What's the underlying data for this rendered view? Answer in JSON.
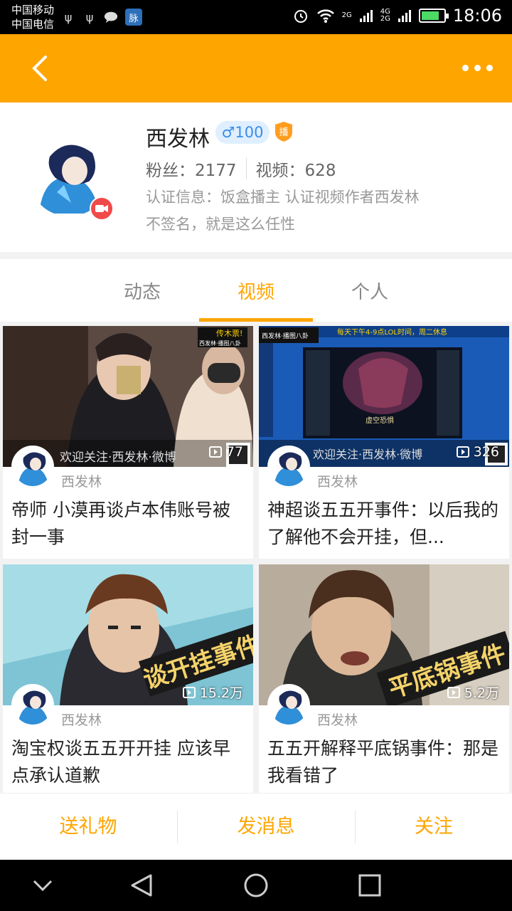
{
  "status": {
    "carrier1": "中国移动",
    "carrier2": "中国电信",
    "mai": "脉",
    "net_top": "4G",
    "net_bottom": "2G",
    "net2": "2G",
    "time": "18:06"
  },
  "profile": {
    "name": "西发林",
    "level": "♂100",
    "badge": "播",
    "fans": "粉丝：2177",
    "videos": "视频：628",
    "cert": "认证信息：饭盒播主 认证视频作者西发林",
    "sign": "不签名，就是这么任性"
  },
  "tabs": [
    "动态",
    "视频",
    "个人"
  ],
  "cards": [
    {
      "count": "77",
      "author": "西发林",
      "title": "帝师 小漠再谈卢本伟账号被封一事"
    },
    {
      "count": "326",
      "author": "西发林",
      "title": "神超谈五五开事件：以后我的了解他不会开挂，但..."
    },
    {
      "count": "15.2万",
      "author": "西发林",
      "title": "淘宝权谈五五开开挂 应该早点承认道歉",
      "overlay": "谈开挂事件"
    },
    {
      "count": "5.2万",
      "author": "西发林",
      "title": "五五开解释平底锅事件：那是我看错了",
      "overlay": "平底锅事件"
    }
  ],
  "thumb_texts": {
    "c1_logo": "传木票!",
    "c1_bar": "西发林·播图八卦",
    "c1_scroll": "欢迎关注·西发林·微博",
    "c2_top": "每天下午4-9点LOL时间，周二休息",
    "c2_char": "虚空恐惧",
    "c2_bar": "西发林·播图八卦",
    "c2_scroll": "欢迎关注·西发林·微博"
  },
  "bottom": {
    "gift": "送礼物",
    "msg": "发消息",
    "follow": "关注"
  },
  "colors": {
    "accent": "#ffa500",
    "cam": "#f04a4a"
  }
}
